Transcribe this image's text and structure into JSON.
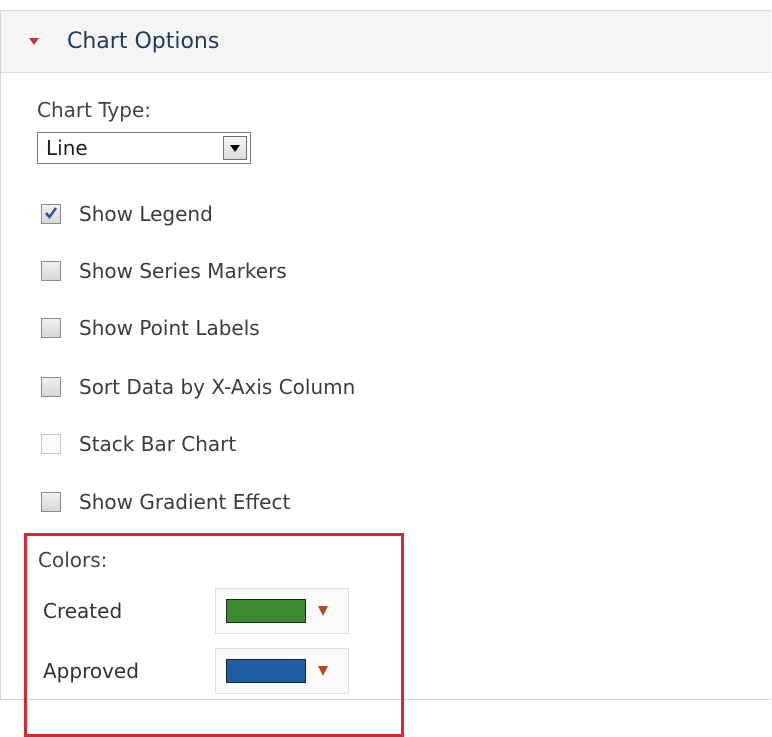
{
  "header": {
    "title": "Chart Options",
    "expand_state": "expanded"
  },
  "chart_type": {
    "label": "Chart Type:",
    "selected": "Line"
  },
  "options": [
    {
      "label": "Show Legend",
      "checked": true,
      "disabled": false
    },
    {
      "label": "Show Series Markers",
      "checked": false,
      "disabled": false
    },
    {
      "label": "Show Point Labels",
      "checked": false,
      "disabled": false
    },
    {
      "label": "Sort Data by X-Axis Column",
      "checked": false,
      "disabled": false
    },
    {
      "label": "Stack Bar Chart",
      "checked": false,
      "disabled": true
    },
    {
      "label": "Show Gradient Effect",
      "checked": false,
      "disabled": false
    }
  ],
  "colors": {
    "title": "Colors:",
    "highlight_color": "#e02530",
    "items": [
      {
        "label": "Created",
        "color": "#3d8a32"
      },
      {
        "label": "Approved",
        "color": "#1f5fa3"
      }
    ]
  },
  "theme": {
    "header_text_color": "#1f3a5a",
    "accent_caret_color": "#c0382b",
    "checkmark_color": "#2a4e9a"
  }
}
